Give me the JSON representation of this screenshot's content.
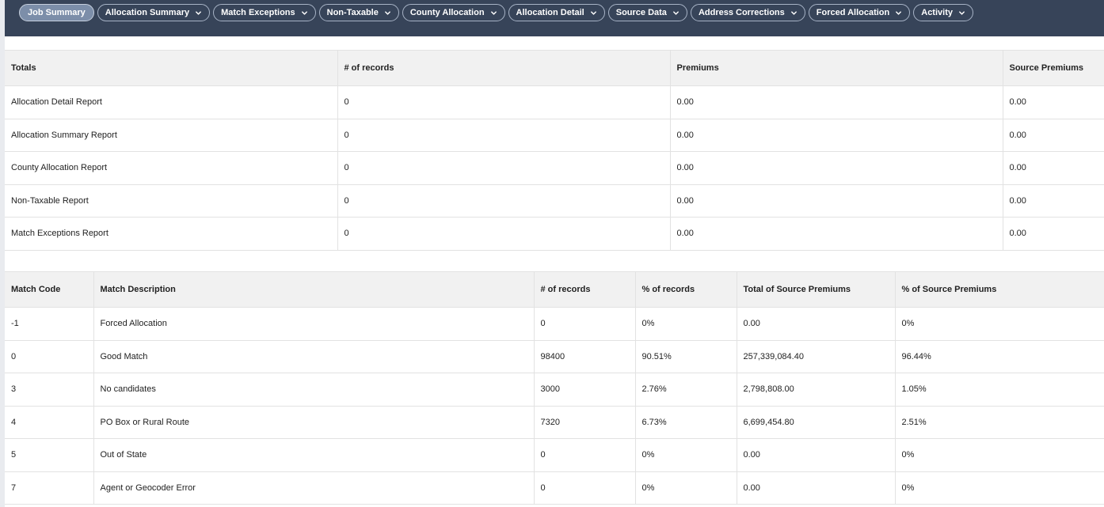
{
  "nav": {
    "tabs": [
      {
        "label": "Job Summary",
        "has_dropdown": false,
        "active": true
      },
      {
        "label": "Allocation Summary",
        "has_dropdown": true
      },
      {
        "label": "Match Exceptions",
        "has_dropdown": true
      },
      {
        "label": "Non-Taxable",
        "has_dropdown": true
      },
      {
        "label": "County Allocation",
        "has_dropdown": true
      },
      {
        "label": "Allocation Detail",
        "has_dropdown": true
      },
      {
        "label": "Source Data",
        "has_dropdown": true
      },
      {
        "label": "Address Corrections",
        "has_dropdown": true
      },
      {
        "label": "Forced Allocation",
        "has_dropdown": true
      },
      {
        "label": "Activity",
        "has_dropdown": true
      }
    ]
  },
  "totals_table": {
    "headers": [
      "Totals",
      "# of records",
      "Premiums",
      "Source Premiums"
    ],
    "rows": [
      [
        "Allocation Detail Report",
        "0",
        "0.00",
        "0.00"
      ],
      [
        "Allocation Summary Report",
        "0",
        "0.00",
        "0.00"
      ],
      [
        "County Allocation Report",
        "0",
        "0.00",
        "0.00"
      ],
      [
        "Non-Taxable Report",
        "0",
        "0.00",
        "0.00"
      ],
      [
        "Match Exceptions Report",
        "0",
        "0.00",
        "0.00"
      ]
    ]
  },
  "match_table": {
    "headers": [
      "Match Code",
      "Match Description",
      "# of records",
      "% of records",
      "Total of Source Premiums",
      "% of Source Premiums"
    ],
    "rows": [
      [
        "-1",
        "Forced Allocation",
        "0",
        "0%",
        "0.00",
        "0%"
      ],
      [
        "0",
        "Good Match",
        "98400",
        "90.51%",
        "257,339,084.40",
        "96.44%"
      ],
      [
        "3",
        "No candidates",
        "3000",
        "2.76%",
        "2,798,808.00",
        "1.05%"
      ],
      [
        "4",
        "PO Box or Rural Route",
        "7320",
        "6.73%",
        "6,699,454.80",
        "2.51%"
      ],
      [
        "5",
        "Out of State",
        "0",
        "0%",
        "0.00",
        "0%"
      ],
      [
        "7",
        "Agent or Geocoder Error",
        "0",
        "0%",
        "0.00",
        "0%"
      ]
    ]
  },
  "colors": {
    "topbar": "#374459",
    "active_tab": "#7c8ea9",
    "header_bg": "#f1f1f1"
  }
}
